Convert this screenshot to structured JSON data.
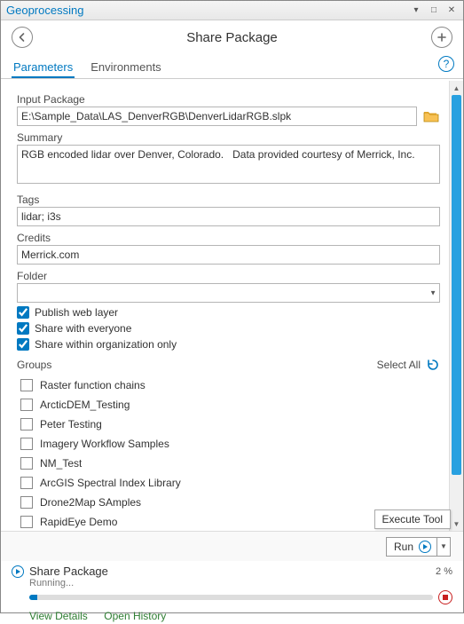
{
  "window": {
    "title": "Geoprocessing"
  },
  "header": {
    "tool_title": "Share Package"
  },
  "tabs": {
    "parameters": "Parameters",
    "environments": "Environments",
    "help_glyph": "?"
  },
  "fields": {
    "input_package": {
      "label": "Input Package",
      "value": "E:\\Sample_Data\\LAS_DenverRGB\\DenverLidarRGB.slpk"
    },
    "summary": {
      "label": "Summary",
      "value": "RGB encoded lidar over Denver, Colorado.   Data provided courtesy of Merrick, Inc."
    },
    "tags": {
      "label": "Tags",
      "value": "lidar; i3s"
    },
    "credits": {
      "label": "Credits",
      "value": "Merrick.com"
    },
    "folder": {
      "label": "Folder",
      "value": ""
    }
  },
  "options": {
    "publish_web_layer": {
      "label": "Publish web layer",
      "checked": true
    },
    "share_everyone": {
      "label": "Share with everyone",
      "checked": true
    },
    "share_org": {
      "label": "Share within organization only",
      "checked": true
    }
  },
  "groups": {
    "label": "Groups",
    "select_all": "Select All",
    "items": [
      "Raster function chains",
      "ArcticDEM_Testing",
      "Peter Testing",
      "Imagery Workflow Samples",
      "NM_Test",
      "ArcGIS Spectral Index Library",
      "Drone2Map SAmples",
      "RapidEye Demo"
    ]
  },
  "run": {
    "label": "Run",
    "tooltip": "Execute Tool"
  },
  "status": {
    "title": "Share Package",
    "state": "Running...",
    "percent_label": "2 %",
    "percent_value": 2,
    "view_details": "View Details",
    "open_history": "Open History"
  }
}
